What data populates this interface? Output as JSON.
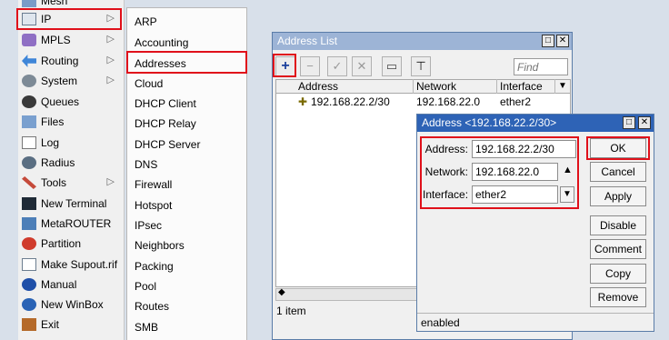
{
  "menu": {
    "top_partial_label": "Mesh",
    "items": [
      {
        "label": "IP",
        "icon": "ip-icon",
        "submenu": true
      },
      {
        "label": "MPLS",
        "icon": "mpls-icon",
        "submenu": true
      },
      {
        "label": "Routing",
        "icon": "routing-icon",
        "submenu": true
      },
      {
        "label": "System",
        "icon": "system-gear-icon",
        "submenu": true
      },
      {
        "label": "Queues",
        "icon": "queues-icon",
        "submenu": false
      },
      {
        "label": "Files",
        "icon": "folder-icon",
        "submenu": false
      },
      {
        "label": "Log",
        "icon": "log-icon",
        "submenu": false
      },
      {
        "label": "Radius",
        "icon": "radius-icon",
        "submenu": false
      },
      {
        "label": "Tools",
        "icon": "tools-icon",
        "submenu": true
      },
      {
        "label": "New Terminal",
        "icon": "terminal-icon",
        "submenu": false
      },
      {
        "label": "MetaROUTER",
        "icon": "metarouter-icon",
        "submenu": false
      },
      {
        "label": "Partition",
        "icon": "partition-icon",
        "submenu": false
      },
      {
        "label": "Make Supout.rif",
        "icon": "document-icon",
        "submenu": false
      },
      {
        "label": "Manual",
        "icon": "help-icon",
        "submenu": false
      },
      {
        "label": "New WinBox",
        "icon": "winbox-icon",
        "submenu": false
      },
      {
        "label": "Exit",
        "icon": "exit-icon",
        "submenu": false
      }
    ]
  },
  "submenu": {
    "items": [
      "ARP",
      "Accounting",
      "Addresses",
      "Cloud",
      "DHCP Client",
      "DHCP Relay",
      "DHCP Server",
      "DNS",
      "Firewall",
      "Hotspot",
      "IPsec",
      "Neighbors",
      "Packing",
      "Pool",
      "Routes",
      "SMB"
    ]
  },
  "address_list": {
    "title": "Address List",
    "find_placeholder": "Find",
    "columns": [
      "Address",
      "Network",
      "Interface"
    ],
    "rows": [
      {
        "address": "192.168.22.2/30",
        "network": "192.168.22.0",
        "interface": "ether2"
      }
    ],
    "status": "1 item",
    "tool_glyphs": {
      "add": "+",
      "remove": "−",
      "enable": "✓",
      "disable": "✕",
      "comment": "▭",
      "filter": "⊤"
    }
  },
  "dialog": {
    "title": "Address <192.168.22.2/30>",
    "address_label": "Address:",
    "address_value": "192.168.22.2/30",
    "network_label": "Network:",
    "network_value": "192.168.22.0",
    "interface_label": "Interface:",
    "interface_value": "ether2",
    "buttons": {
      "ok": "OK",
      "cancel": "Cancel",
      "apply": "Apply",
      "disable": "Disable",
      "comment": "Comment",
      "copy": "Copy",
      "remove": "Remove"
    },
    "status": "enabled"
  },
  "window_controls": {
    "maximize": "□",
    "close": "✕"
  },
  "colors": {
    "highlight": "#e0101a",
    "title_active": "#2e63b6",
    "title_inactive": "#9db4d6"
  }
}
